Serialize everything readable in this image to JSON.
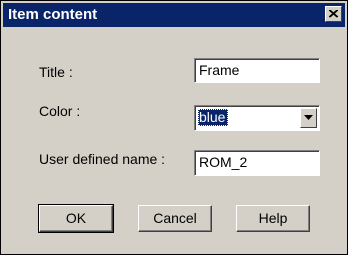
{
  "dialog": {
    "title": "Item content",
    "close_glyph": "close-icon"
  },
  "form": {
    "title_label": "Title :",
    "title_value": "Frame",
    "color_label": "Color :",
    "color_value": "blue",
    "user_name_label": "User defined name :",
    "user_name_value": "ROM_2"
  },
  "buttons": {
    "ok": "OK",
    "cancel": "Cancel",
    "help": "Help"
  },
  "colors": {
    "titlebar": "#0a246a",
    "face": "#d4d0c8"
  }
}
